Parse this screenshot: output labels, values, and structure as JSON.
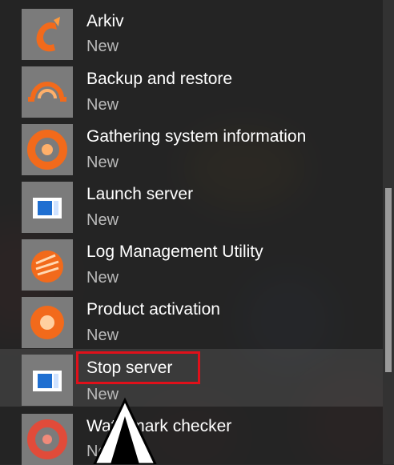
{
  "colors": {
    "panel_bg": "#222222",
    "tile_bg": "#7b7b7b",
    "accent_orange": "#f26a1b",
    "icon_blue": "#1f6fd1",
    "highlight_red": "#e0101a"
  },
  "menu": {
    "items": [
      {
        "label": "Arkiv",
        "badge": "New",
        "icon": "arkiv-icon"
      },
      {
        "label": "Backup and restore",
        "badge": "New",
        "icon": "backup-restore-icon"
      },
      {
        "label": "Gathering system information",
        "badge": "New",
        "icon": "system-info-icon"
      },
      {
        "label": "Launch server",
        "badge": "New",
        "icon": "launch-server-icon"
      },
      {
        "label": "Log Management Utility",
        "badge": "New",
        "icon": "log-management-icon"
      },
      {
        "label": "Product activation",
        "badge": "New",
        "icon": "product-activation-icon"
      },
      {
        "label": "Stop server",
        "badge": "New",
        "icon": "stop-server-icon"
      },
      {
        "label": "Watermark checker",
        "badge": "New",
        "icon": "watermark-checker-icon"
      }
    ]
  }
}
